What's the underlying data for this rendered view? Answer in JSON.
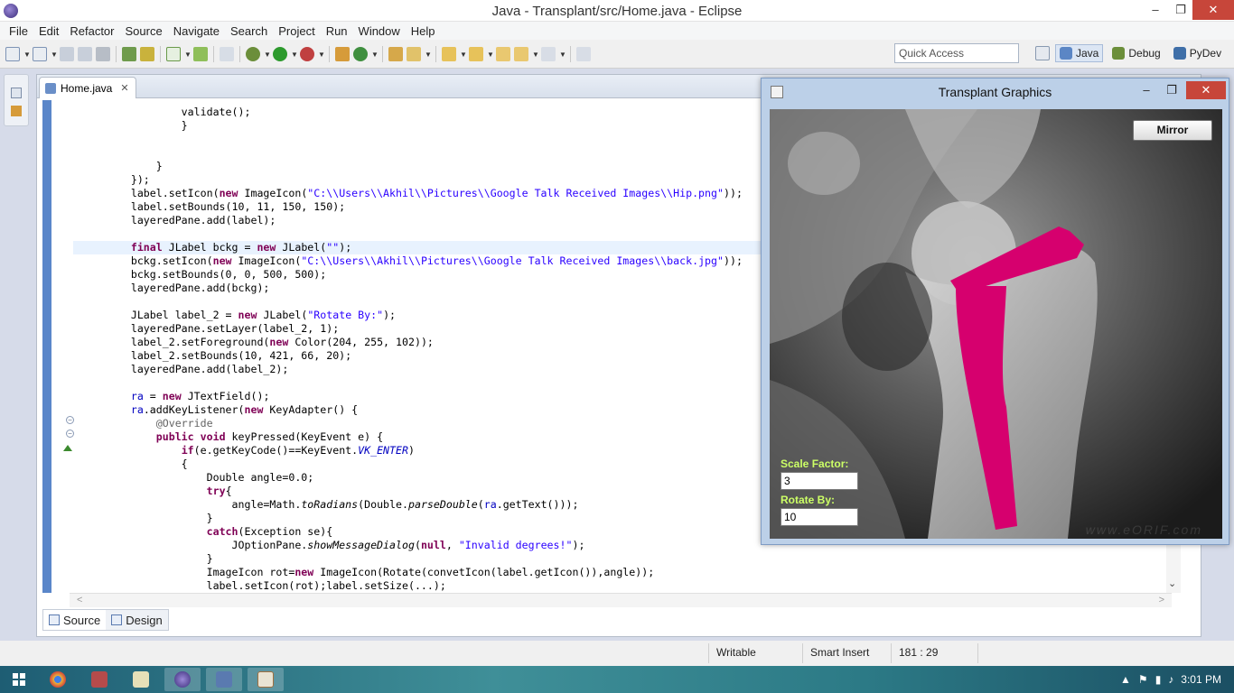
{
  "window": {
    "title": "Java - Transplant/src/Home.java - Eclipse",
    "minimize": "–",
    "maximize": "❐",
    "close": "✕"
  },
  "menu": [
    "File",
    "Edit",
    "Refactor",
    "Source",
    "Navigate",
    "Search",
    "Project",
    "Run",
    "Window",
    "Help"
  ],
  "toolbar": {
    "quick_access_placeholder": "Quick Access"
  },
  "perspectives": [
    {
      "label": "Java",
      "active": true,
      "color": "#5b86c5"
    },
    {
      "label": "Debug",
      "active": false,
      "color": "#6b8e3a"
    },
    {
      "label": "PyDev",
      "active": false,
      "color": "#3f6fa8"
    }
  ],
  "editor": {
    "tab_label": "Home.java",
    "tab_close": "✕",
    "bottom_tabs": [
      {
        "label": "Source",
        "active": true
      },
      {
        "label": "Design",
        "active": false
      }
    ]
  },
  "code_lines": [
    [
      {
        "t": "                validate();"
      }
    ],
    [
      {
        "t": "                }"
      }
    ],
    [
      {
        "t": ""
      }
    ],
    [
      {
        "t": ""
      }
    ],
    [
      {
        "t": "            }"
      }
    ],
    [
      {
        "t": "        });"
      }
    ],
    [
      {
        "t": "        label.setIcon("
      },
      {
        "t": "new",
        "c": "kw"
      },
      {
        "t": " ImageIcon("
      },
      {
        "t": "\"C:\\\\Users\\\\Akhil\\\\Pictures\\\\Google Talk Received Images\\\\Hip.png\"",
        "c": "str"
      },
      {
        "t": "));"
      }
    ],
    [
      {
        "t": "        label.setBounds(10, 11, 150, 150);"
      }
    ],
    [
      {
        "t": "        layeredPane.add(label);"
      }
    ],
    [
      {
        "t": ""
      }
    ],
    [
      {
        "t": "final",
        "c": "kw"
      },
      {
        "t": " JLabel bckg = "
      },
      {
        "t": "new",
        "c": "kw"
      },
      {
        "t": " JLabel("
      },
      {
        "t": "\"\"",
        "c": "str"
      },
      {
        "t": ");"
      }
    ],
    [
      {
        "t": "        bckg.setIcon("
      },
      {
        "t": "new",
        "c": "kw"
      },
      {
        "t": " ImageIcon("
      },
      {
        "t": "\"C:\\\\Users\\\\Akhil\\\\Pictures\\\\Google Talk Received Images\\\\back.jpg\"",
        "c": "str"
      },
      {
        "t": "));"
      }
    ],
    [
      {
        "t": "        bckg.setBounds(0, 0, 500, 500);"
      }
    ],
    [
      {
        "t": "        layeredPane.add(bckg);"
      }
    ],
    [
      {
        "t": ""
      }
    ],
    [
      {
        "t": "        JLabel label_2 = "
      },
      {
        "t": "new",
        "c": "kw"
      },
      {
        "t": " JLabel("
      },
      {
        "t": "\"Rotate By:\"",
        "c": "str"
      },
      {
        "t": ");"
      }
    ],
    [
      {
        "t": "        layeredPane.setLayer(label_2, 1);"
      }
    ],
    [
      {
        "t": "        label_2.setForeground("
      },
      {
        "t": "new",
        "c": "kw"
      },
      {
        "t": " Color(204, 255, 102));"
      }
    ],
    [
      {
        "t": "        label_2.setBounds(10, 421, 66, 20);"
      }
    ],
    [
      {
        "t": "        layeredPane.add(label_2);"
      }
    ],
    [
      {
        "t": ""
      }
    ],
    [
      {
        "t": "        "
      },
      {
        "t": "ra",
        "c": "fld"
      },
      {
        "t": " = "
      },
      {
        "t": "new",
        "c": "kw"
      },
      {
        "t": " JTextField();"
      }
    ],
    [
      {
        "t": "        "
      },
      {
        "t": "ra",
        "c": "fld"
      },
      {
        "t": ".addKeyListener("
      },
      {
        "t": "new",
        "c": "kw"
      },
      {
        "t": " KeyAdapter() {"
      }
    ],
    [
      {
        "t": "            "
      },
      {
        "t": "@Override",
        "c": "ann"
      }
    ],
    [
      {
        "t": "            "
      },
      {
        "t": "public",
        "c": "kw"
      },
      {
        "t": " "
      },
      {
        "t": "void",
        "c": "kw"
      },
      {
        "t": " keyPressed(KeyEvent e) {"
      }
    ],
    [
      {
        "t": "                "
      },
      {
        "t": "if",
        "c": "kw"
      },
      {
        "t": "(e.getKeyCode()==KeyEvent."
      },
      {
        "t": "VK_ENTER",
        "c": "sfld"
      },
      {
        "t": ")"
      }
    ],
    [
      {
        "t": "                {"
      }
    ],
    [
      {
        "t": "                    Double angle=0.0;"
      }
    ],
    [
      {
        "t": "                    "
      },
      {
        "t": "try",
        "c": "kw"
      },
      {
        "t": "{"
      }
    ],
    [
      {
        "t": "                        angle=Math."
      },
      {
        "t": "toRadians",
        "c": "ital"
      },
      {
        "t": "(Double."
      },
      {
        "t": "parseDouble",
        "c": "ital"
      },
      {
        "t": "("
      },
      {
        "t": "ra",
        "c": "fld"
      },
      {
        "t": ".getText()));"
      }
    ],
    [
      {
        "t": "                    }"
      }
    ],
    [
      {
        "t": "                    "
      },
      {
        "t": "catch",
        "c": "kw"
      },
      {
        "t": "(Exception se){"
      }
    ],
    [
      {
        "t": "                        JOptionPane."
      },
      {
        "t": "showMessageDialog",
        "c": "ital"
      },
      {
        "t": "("
      },
      {
        "t": "null",
        "c": "kw"
      },
      {
        "t": ", "
      },
      {
        "t": "\"Invalid degrees!\"",
        "c": "str"
      },
      {
        "t": ");"
      }
    ],
    [
      {
        "t": "                    }"
      }
    ],
    [
      {
        "t": "                    ImageIcon rot="
      },
      {
        "t": "new",
        "c": "kw"
      },
      {
        "t": " ImageIcon(Rotate(convetIcon(label.getIcon()),angle));"
      }
    ],
    [
      {
        "t": "                    label.setIcon(rot);label.setSize(...);"
      }
    ]
  ],
  "status": {
    "writable": "Writable",
    "insert_mode": "Smart Insert",
    "position": "181 : 29"
  },
  "taskbar": {
    "clock": "3:01 PM"
  },
  "jframe": {
    "title": "Transplant Graphics",
    "mirror_label": "Mirror",
    "scale_label": "Scale Factor:",
    "scale_value": "3",
    "rotate_label": "Rotate By:",
    "rotate_value": "10",
    "watermark": "www.eORIF.com",
    "implant_color": "#d6006e",
    "label_color": "#ccff66"
  }
}
